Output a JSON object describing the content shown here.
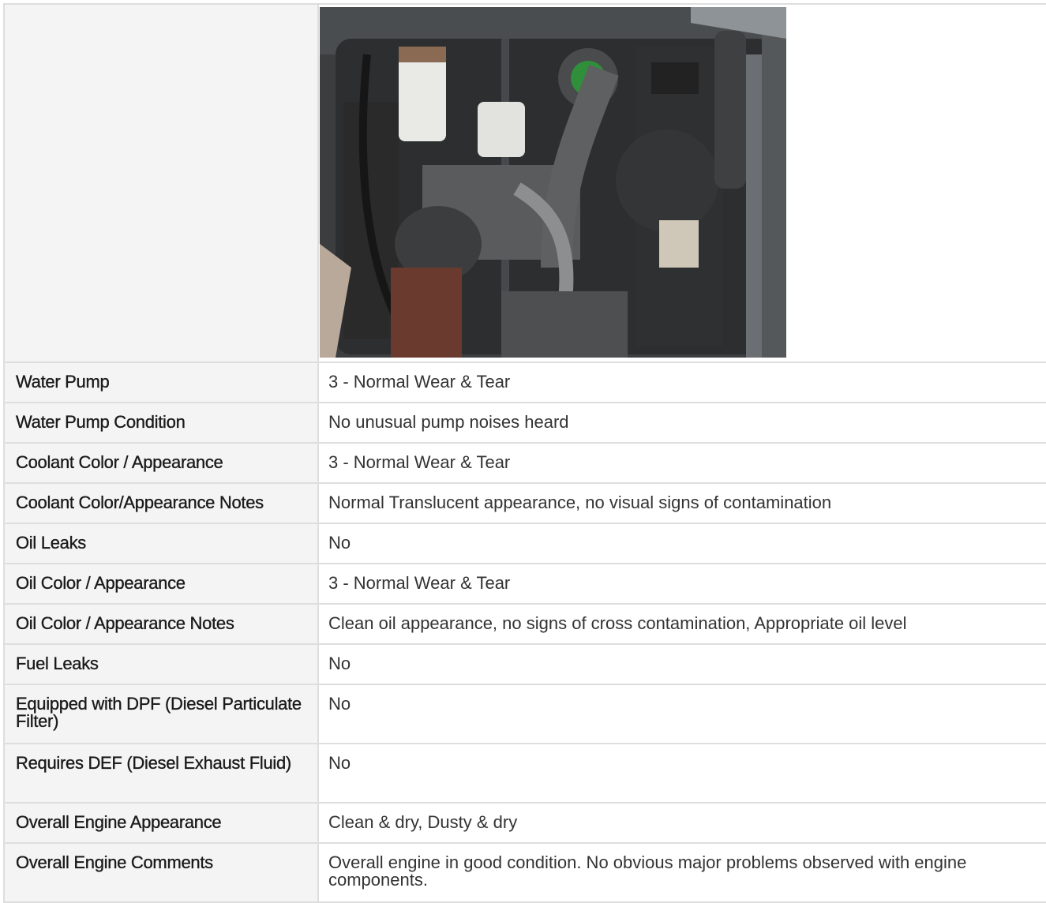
{
  "photo": {
    "icon": "engine-bay-photo"
  },
  "rows": [
    {
      "label": "Water Pump",
      "value": "3 - Normal Wear & Tear"
    },
    {
      "label": "Water Pump Condition",
      "value": "No unusual pump noises heard"
    },
    {
      "label": "Coolant Color / Appearance",
      "value": "3 - Normal Wear & Tear"
    },
    {
      "label": "Coolant Color/Appearance Notes",
      "value": "Normal Translucent appearance, no visual signs of contamination"
    },
    {
      "label": "Oil Leaks",
      "value": "No"
    },
    {
      "label": "Oil Color / Appearance",
      "value": "3 - Normal Wear & Tear"
    },
    {
      "label": "Oil Color / Appearance Notes",
      "value": "Clean oil appearance, no signs of cross contamination, Appropriate oil level"
    },
    {
      "label": "Fuel Leaks",
      "value": "No"
    },
    {
      "label": "Equipped with DPF (Diesel Particulate Filter)",
      "value": "No"
    },
    {
      "label": "Requires DEF (Diesel Exhaust Fluid)",
      "value": "No"
    },
    {
      "label": "Overall Engine Appearance",
      "value": "Clean & dry, Dusty & dry"
    },
    {
      "label": "Overall Engine Comments",
      "value": "Overall engine in good condition. No obvious major problems observed with engine components."
    }
  ]
}
